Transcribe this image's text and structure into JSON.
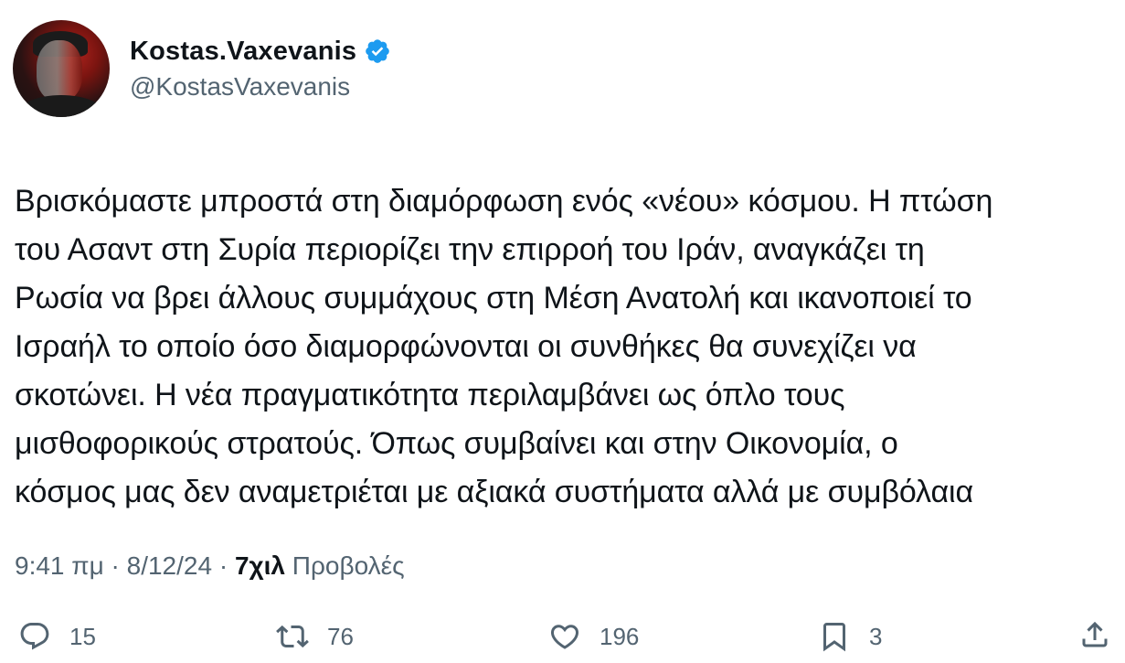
{
  "author": {
    "display_name": "Kostas.Vaxevanis",
    "handle": "@KostasVaxevanis",
    "verified": true,
    "verified_color": "#1d9bf0"
  },
  "tweet": {
    "text": "Βρισκόμαστε μπροστά στη διαμόρφωση ενός «νέου» κόσμου. Η πτώση\nτου Ασαντ στη Συρία περιορίζει την επιρροή του Ιράν, αναγκάζει τη\nΡωσία να βρει άλλους συμμάχους στη Μέση Ανατολή και ικανοποιεί το\nΙσραήλ το οποίο όσο διαμορφώνονται οι συνθήκες θα συνεχίζει να\nσκοτώνει. Η νέα πραγματικότητα περιλαμβάνει ως όπλο τους\nμισθοφορικούς στρατούς. Όπως συμβαίνει και στην Οικονομία, ο\nκόσμος μας δεν αναμετριέται με αξιακά συστήματα αλλά με συμβόλαια"
  },
  "meta": {
    "time": "9:41 πμ",
    "separator": " · ",
    "date": "8/12/24",
    "views_count": "7χιλ",
    "views_label": "Προβολές"
  },
  "actions": {
    "reply_count": "15",
    "retweet_count": "76",
    "like_count": "196",
    "bookmark_count": "3",
    "icons": [
      "reply-icon",
      "retweet-icon",
      "like-icon",
      "bookmark-icon",
      "share-icon"
    ],
    "icon_color": "#536471"
  }
}
